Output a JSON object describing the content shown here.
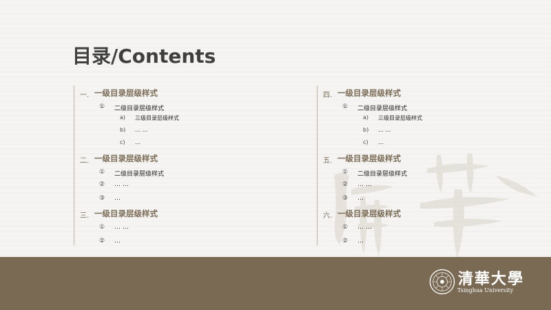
{
  "slide": {
    "title": "目录/Contents"
  },
  "toc": {
    "left": [
      {
        "level": 1,
        "num": "一.",
        "text": "一级目录层级样式"
      },
      {
        "level": 2,
        "num": "①",
        "text": "二级目录层级样式"
      },
      {
        "level": 3,
        "num": "a)",
        "text": "三级目录层级样式"
      },
      {
        "level": 3,
        "num": "b)",
        "text": "… …"
      },
      {
        "level": 3,
        "num": "c)",
        "text": "…"
      },
      {
        "level": 1,
        "num": "二.",
        "text": "一级目录层级样式"
      },
      {
        "level": 2,
        "num": "①",
        "text": "二级目录层级样式"
      },
      {
        "level": 2,
        "num": "②",
        "text": "… …"
      },
      {
        "level": 2,
        "num": "③",
        "text": "…"
      },
      {
        "level": 1,
        "num": "三.",
        "text": "一级目录层级样式"
      },
      {
        "level": 2,
        "num": "①",
        "text": "… …"
      },
      {
        "level": 2,
        "num": "②",
        "text": "…"
      }
    ],
    "right": [
      {
        "level": 1,
        "num": "四.",
        "text": "一级目录层级样式"
      },
      {
        "level": 2,
        "num": "①",
        "text": "二级目录层级样式"
      },
      {
        "level": 3,
        "num": "a)",
        "text": "三级目录层级样式"
      },
      {
        "level": 3,
        "num": "b)",
        "text": "… …"
      },
      {
        "level": 3,
        "num": "c)",
        "text": "…"
      },
      {
        "level": 1,
        "num": "五.",
        "text": "一级目录层级样式"
      },
      {
        "level": 2,
        "num": "①",
        "text": "二级目录层级样式"
      },
      {
        "level": 2,
        "num": "②",
        "text": "… …"
      },
      {
        "level": 2,
        "num": "③",
        "text": "…"
      },
      {
        "level": 1,
        "num": "六.",
        "text": "一级目录层级样式"
      },
      {
        "level": 2,
        "num": "①",
        "text": "… …"
      },
      {
        "level": 2,
        "num": "②",
        "text": "…"
      }
    ]
  },
  "footer": {
    "university_cn": "清華大學",
    "university_en": "Tsinghua University"
  },
  "colors": {
    "accent": "#7a6a54",
    "heading": "#7a6b56",
    "title": "#3f3f3f"
  },
  "icons": {
    "seal": "tsinghua-seal-icon",
    "watermark": "calligraphy-watermark"
  }
}
